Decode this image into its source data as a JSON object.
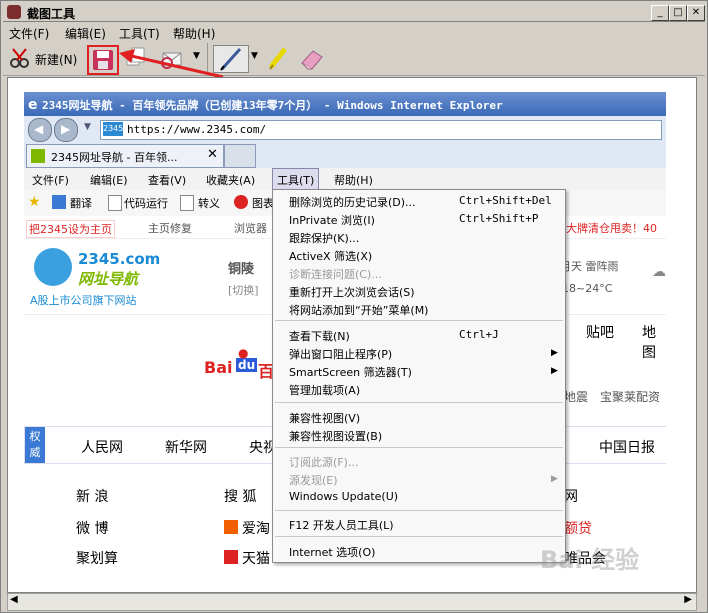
{
  "app": {
    "title": "截图工具",
    "menu": [
      "文件(F)",
      "编辑(E)",
      "工具(T)",
      "帮助(H)"
    ],
    "new_label": "新建(N)",
    "window_controls": [
      "minimize-icon",
      "maximize-icon",
      "close-icon"
    ]
  },
  "ie": {
    "title": "2345网址导航 - 百年领先品牌（已创建13年零7个月） - Windows Internet Explorer",
    "address": "https://www.2345.com/",
    "tab_label": "2345网址导航 - 百年领...",
    "menu": [
      "文件(F)",
      "编辑(E)",
      "查看(V)",
      "收藏夹(A)",
      "工具(T)",
      "帮助(H)"
    ],
    "favbar": [
      "翻译",
      "代码运行",
      "转义",
      "图表"
    ],
    "page": {
      "bar_items": [
        "把2345设为主页",
        "主页修复",
        "浏览器"
      ],
      "bar_right": "大牌清仓甩卖！40",
      "logo_text": "2345.com",
      "logo_sub": "网址导航",
      "logo_tag": "A股上市公司旗下网站",
      "city": "铜陵",
      "city_switch": "[切换]",
      "weather_text": "月天 雷阵雨",
      "weather_temp": "18~24°C",
      "nav_right": [
        "贴吧",
        "地图"
      ],
      "baidu_text": "Bai",
      "baidu_du": "du",
      "baidu_tail": "百",
      "promo_right": [
        "地震",
        "宝聚莱配资"
      ],
      "authority_label": "权威",
      "authority_links": [
        "人民网",
        "新华网",
        "央视",
        "中国日报"
      ],
      "grid_left": [
        "新 浪",
        "微 博",
        "聚划算"
      ],
      "grid_mid": [
        "搜 狐",
        "爱淘",
        "天猫"
      ],
      "grid_right": [
        "网",
        "额贷",
        "唯品会"
      ]
    }
  },
  "tools_menu": {
    "items": [
      {
        "label": "删除浏览的历史记录(D)...",
        "shortcut": "Ctrl+Shift+Del"
      },
      {
        "label": "InPrivate 浏览(I)",
        "shortcut": "Ctrl+Shift+P"
      },
      {
        "label": "跟踪保护(K)...",
        "shortcut": ""
      },
      {
        "label": "ActiveX 筛选(X)",
        "shortcut": ""
      },
      {
        "label": "诊断连接问题(C)...",
        "shortcut": "",
        "disabled": true
      },
      {
        "label": "重新打开上次浏览会话(S)",
        "shortcut": ""
      },
      {
        "label": "将网站添加到“开始”菜单(M)",
        "shortcut": ""
      },
      {
        "label": "查看下载(N)",
        "shortcut": "Ctrl+J"
      },
      {
        "label": "弹出窗口阻止程序(P)",
        "shortcut": "",
        "submenu": true
      },
      {
        "label": "SmartScreen 筛选器(T)",
        "shortcut": "",
        "submenu": true
      },
      {
        "label": "管理加载项(A)",
        "shortcut": ""
      },
      {
        "label": "兼容性视图(V)",
        "shortcut": ""
      },
      {
        "label": "兼容性视图设置(B)",
        "shortcut": ""
      },
      {
        "label": "订阅此源(F)...",
        "shortcut": "",
        "disabled": true
      },
      {
        "label": "源发现(E)",
        "shortcut": "",
        "disabled": true,
        "submenu": true
      },
      {
        "label": "Windows Update(U)",
        "shortcut": ""
      },
      {
        "label": "F12 开发人员工具(L)",
        "shortcut": ""
      },
      {
        "label": "Internet 选项(O)",
        "shortcut": ""
      }
    ]
  },
  "watermark": "Bai 经验",
  "colors": {
    "ie_title_bg": "#3a6ab8",
    "accent_red": "#e23",
    "logo_blue": "#1a8ad4",
    "logo_green": "#7fb800"
  }
}
